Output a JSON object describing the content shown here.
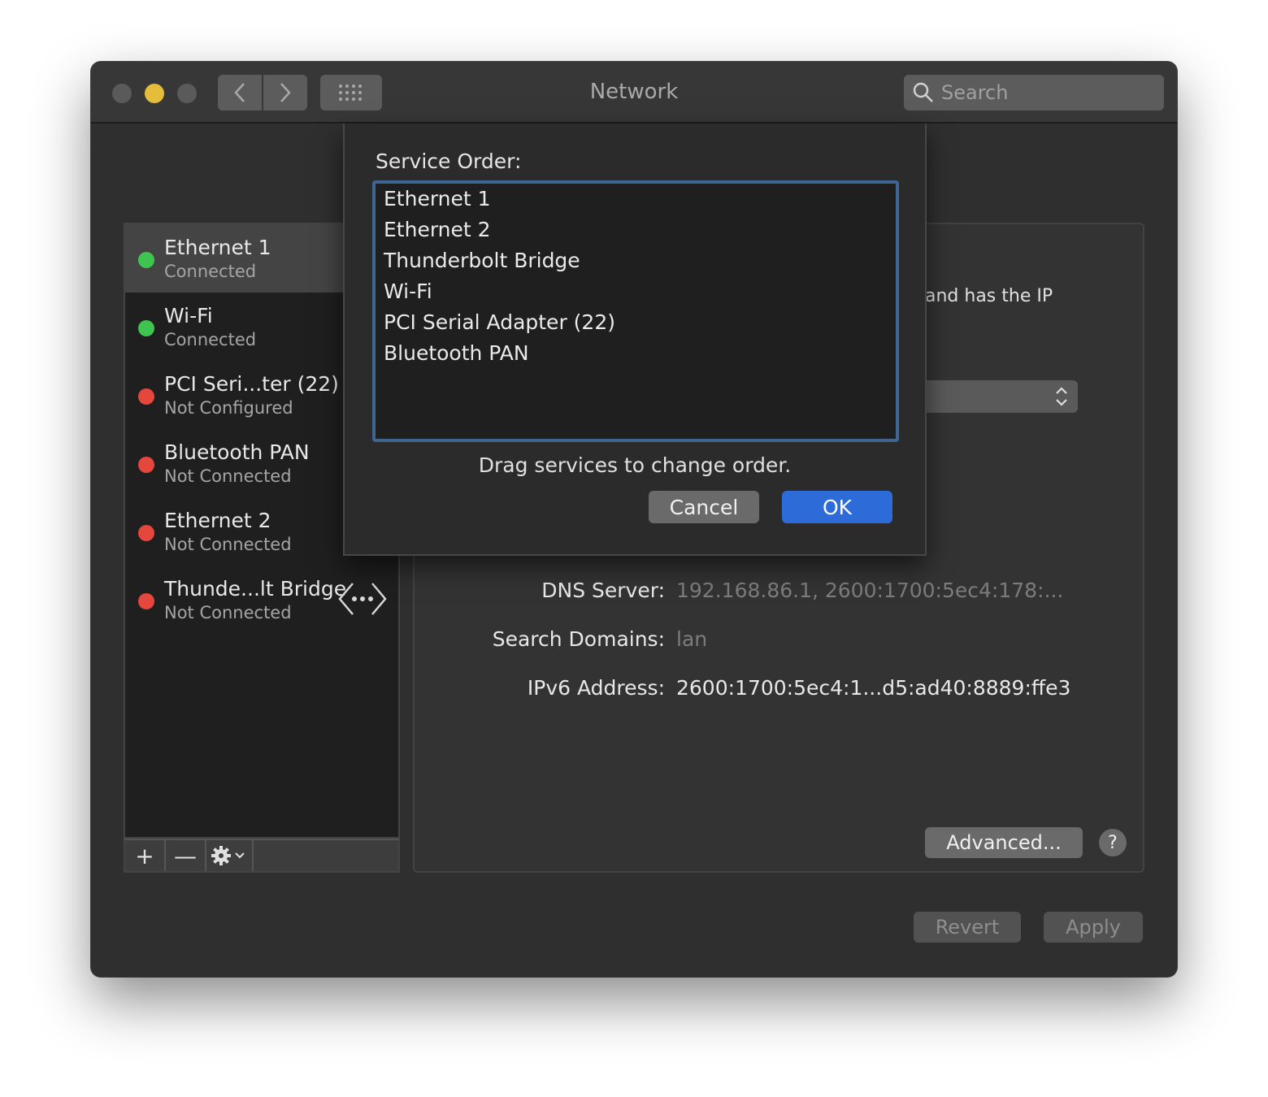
{
  "window": {
    "title": "Network"
  },
  "search": {
    "placeholder": "Search"
  },
  "sidebar": {
    "services": [
      {
        "name": "Ethernet 1",
        "status": "Connected",
        "state": "green"
      },
      {
        "name": "Wi-Fi",
        "status": "Connected",
        "state": "green"
      },
      {
        "name": "PCI Seri...ter (22)",
        "status": "Not Configured",
        "state": "red"
      },
      {
        "name": "Bluetooth PAN",
        "status": "Not Connected",
        "state": "red"
      },
      {
        "name": "Ethernet 2",
        "status": "Not Connected",
        "state": "red"
      },
      {
        "name": "Thunde...lt Bridge",
        "status": "Not Connected",
        "state": "red"
      }
    ],
    "toolbar": {
      "add": "+",
      "remove": "—"
    }
  },
  "detail": {
    "fragment": "and has the IP",
    "dns_label": "DNS Server:",
    "dns_value": "192.168.86.1, 2600:1700:5ec4:178:...",
    "search_domains_label": "Search Domains:",
    "search_domains_value": "lan",
    "ipv6_label": "IPv6 Address:",
    "ipv6_value": "2600:1700:5ec4:1...d5:ad40:8889:ffe3",
    "advanced_label": "Advanced...",
    "help_label": "?"
  },
  "footer": {
    "revert_label": "Revert",
    "apply_label": "Apply"
  },
  "sheet": {
    "label": "Service Order:",
    "order": [
      "Ethernet 1",
      "Ethernet 2",
      "Thunderbolt Bridge",
      "Wi-Fi",
      "PCI Serial Adapter (22)",
      "Bluetooth PAN"
    ],
    "hint": "Drag services to change order.",
    "cancel_label": "Cancel",
    "ok_label": "OK"
  },
  "colors": {
    "accent": "#2c6bd8",
    "connected": "#3fc44f",
    "disconnected": "#e5473d",
    "minimize": "#e4bd3b"
  },
  "icons": {
    "back": "chevron-left-icon",
    "forward": "chevron-right-icon",
    "grid": "grid-icon",
    "search": "search-icon",
    "thunderbolt": "thunderbolt-bridge-icon",
    "gear": "gear-icon",
    "popup": "chevron-up-down-icon"
  }
}
